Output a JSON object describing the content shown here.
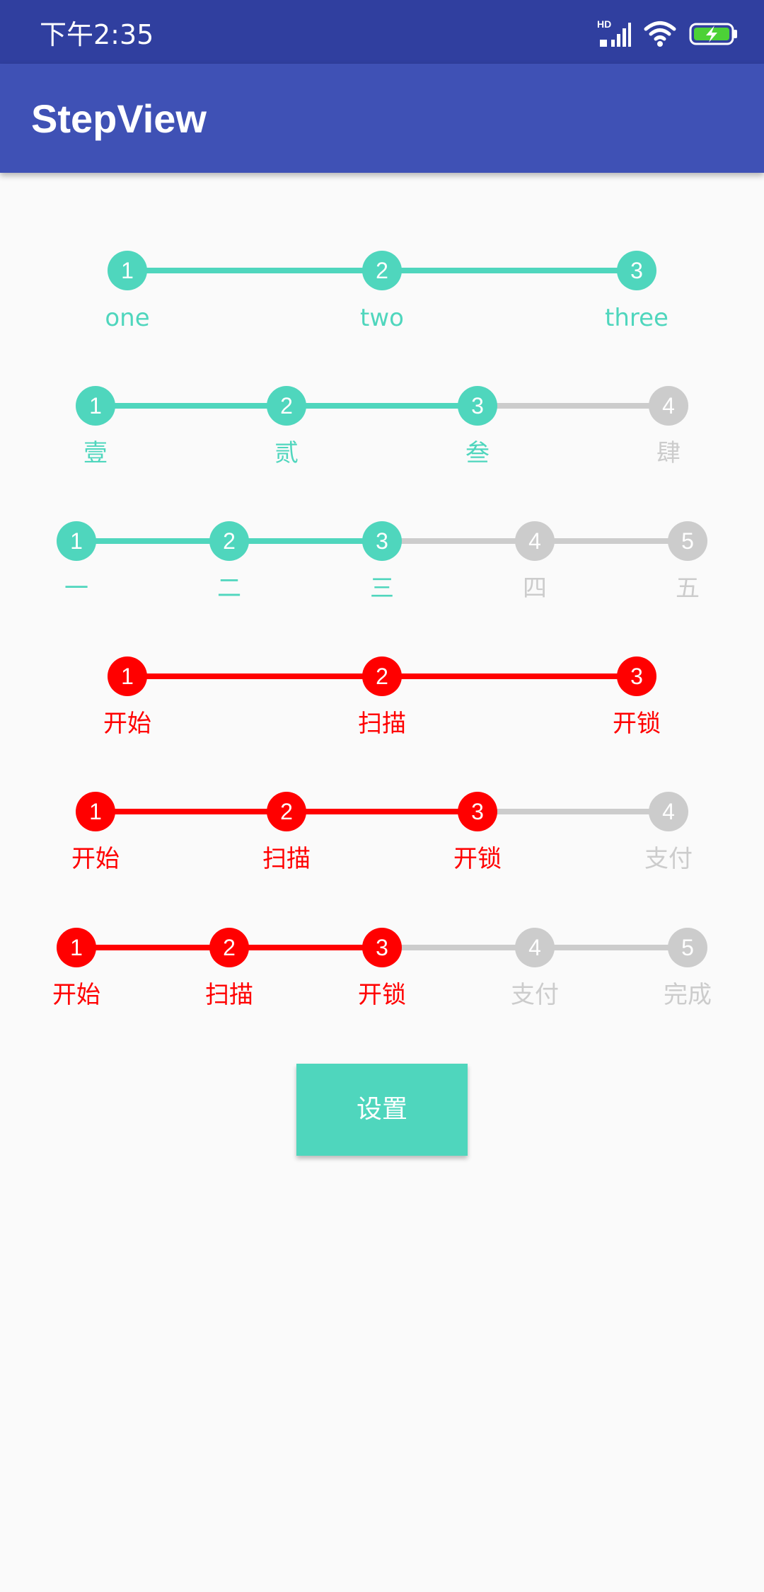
{
  "status_bar": {
    "time": "下午2:35",
    "icons": [
      "hd-signal-icon",
      "wifi-icon",
      "battery-charging-icon"
    ],
    "hd_label": "HD"
  },
  "app_bar": {
    "title": "StepView"
  },
  "colors": {
    "status_bar": "#303f9f",
    "app_bar": "#3f51b5",
    "teal_active": "#4fd6bd",
    "red_active": "#ff0000",
    "inactive": "#cccccc",
    "background": "#fafafa"
  },
  "step_views": [
    {
      "active_color": "#4fd6bd",
      "current_step": 3,
      "steps": [
        {
          "number": "1",
          "label": "one"
        },
        {
          "number": "2",
          "label": "two"
        },
        {
          "number": "3",
          "label": "three"
        }
      ]
    },
    {
      "active_color": "#4fd6bd",
      "current_step": 3,
      "steps": [
        {
          "number": "1",
          "label": "壹"
        },
        {
          "number": "2",
          "label": "贰"
        },
        {
          "number": "3",
          "label": "叁"
        },
        {
          "number": "4",
          "label": "肆"
        }
      ]
    },
    {
      "active_color": "#4fd6bd",
      "current_step": 3,
      "steps": [
        {
          "number": "1",
          "label": "一"
        },
        {
          "number": "2",
          "label": "二"
        },
        {
          "number": "3",
          "label": "三"
        },
        {
          "number": "4",
          "label": "四"
        },
        {
          "number": "5",
          "label": "五"
        }
      ]
    },
    {
      "active_color": "#ff0000",
      "current_step": 3,
      "steps": [
        {
          "number": "1",
          "label": "开始"
        },
        {
          "number": "2",
          "label": "扫描"
        },
        {
          "number": "3",
          "label": "开锁"
        }
      ]
    },
    {
      "active_color": "#ff0000",
      "current_step": 3,
      "steps": [
        {
          "number": "1",
          "label": "开始"
        },
        {
          "number": "2",
          "label": "扫描"
        },
        {
          "number": "3",
          "label": "开锁"
        },
        {
          "number": "4",
          "label": "支付"
        }
      ]
    },
    {
      "active_color": "#ff0000",
      "current_step": 3,
      "steps": [
        {
          "number": "1",
          "label": "开始"
        },
        {
          "number": "2",
          "label": "扫描"
        },
        {
          "number": "3",
          "label": "开锁"
        },
        {
          "number": "4",
          "label": "支付"
        },
        {
          "number": "5",
          "label": "完成"
        }
      ]
    }
  ],
  "settings_button": {
    "label": "设置"
  }
}
